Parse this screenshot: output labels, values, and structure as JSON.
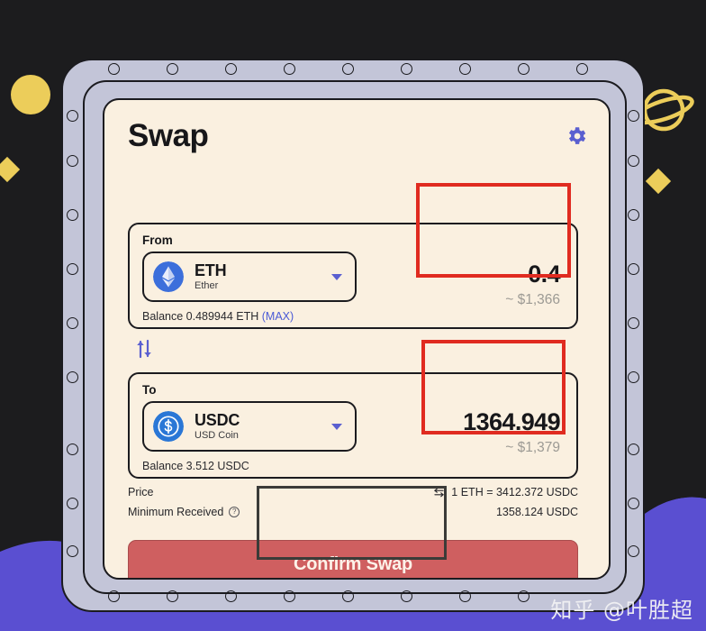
{
  "header": {
    "title": "Swap",
    "settings_icon": "gear-icon"
  },
  "from": {
    "label": "From",
    "token_symbol": "ETH",
    "token_name": "Ether",
    "token_icon": "ethereum-icon",
    "balance_text": "Balance 0.489944 ETH",
    "max_label": "(MAX)",
    "amount": "0.4",
    "amount_usd": "~ $1,366",
    "caret_icon": "chevron-down-icon"
  },
  "swap_direction": {
    "icon": "swap-vertical-arrows-icon"
  },
  "to": {
    "label": "To",
    "token_symbol": "USDC",
    "token_name": "USD Coin",
    "token_icon": "usdc-icon",
    "balance_text": "Balance 3.512 USDC",
    "amount": "1364.949",
    "amount_usd": "~ $1,379",
    "caret_icon": "chevron-down-icon"
  },
  "info": {
    "price_label": "Price",
    "price_value": "1 ETH = 3412.372 USDC",
    "price_swap_icon": "swap-horizontal-icon",
    "minimum_label": "Minimum Received",
    "minimum_help_icon": "question-circle-icon",
    "minimum_value": "1358.124 USDC"
  },
  "action": {
    "confirm_label": "Confirm Swap"
  },
  "watermark": {
    "text": "知乎 @叶胜超"
  },
  "decorations": {
    "planet_icon": "saturn-planet-icon",
    "circle_icon": "yellow-circle-icon",
    "diamond_left_icon": "yellow-diamond-icon",
    "diamond_right_icon": "yellow-diamond-icon"
  },
  "colors": {
    "background": "#1c1c1e",
    "purple_wave": "#5a4fd1",
    "frame": "#c3c5d8",
    "screen": "#faf0e0",
    "accent_blue": "#5a5fd0",
    "token_blue": "#3c6fdb",
    "confirm_red": "#cf5f60",
    "annotation_red": "#e02b20",
    "annotation_dark": "#3b3b38",
    "decor_yellow": "#eccd5a"
  }
}
